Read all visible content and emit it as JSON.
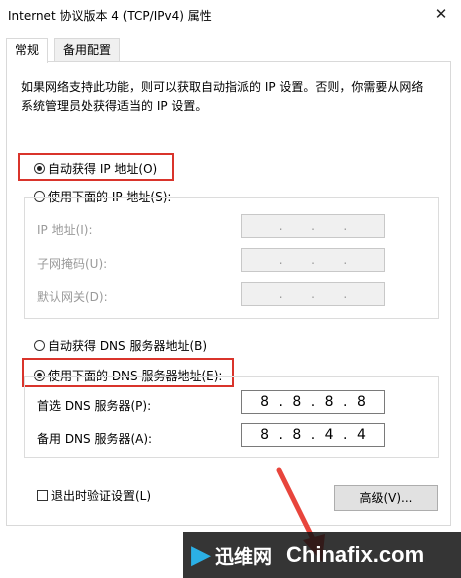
{
  "window": {
    "title": "Internet 协议版本 4 (TCP/IPv4) 属性",
    "close_symbol": "✕"
  },
  "tabs": [
    {
      "label": "常规",
      "active": true
    },
    {
      "label": "备用配置",
      "active": false
    }
  ],
  "description": "如果网络支持此功能，则可以获取自动指派的 IP 设置。否则，你需要从网络系统管理员处获得适当的 IP 设置。",
  "ip_section": {
    "auto_label": "自动获得 IP 地址(O)",
    "auto_checked": true,
    "manual_label": "使用下面的 IP 地址(S):",
    "manual_checked": false,
    "fields": [
      {
        "label": "IP 地址(I):",
        "value": [
          "",
          "",
          "",
          ""
        ]
      },
      {
        "label": "子网掩码(U):",
        "value": [
          "",
          "",
          "",
          ""
        ]
      },
      {
        "label": "默认网关(D):",
        "value": [
          "",
          "",
          "",
          ""
        ]
      }
    ]
  },
  "dns_section": {
    "auto_label": "自动获得 DNS 服务器地址(B)",
    "auto_checked": false,
    "manual_label": "使用下面的 DNS 服务器地址(E):",
    "manual_checked": true,
    "preferred_label": "首选 DNS 服务器(P):",
    "preferred_value": [
      "8",
      "8",
      "8",
      "8"
    ],
    "alternate_label": "备用 DNS 服务器(A):",
    "alternate_value": [
      "8",
      "8",
      "4",
      "4"
    ]
  },
  "validate_label": "退出时验证设置(L)",
  "validate_checked": false,
  "advanced_label": "高级(V)...",
  "watermark": {
    "logo": "迅维网",
    "site": "Chinafix.com"
  },
  "colors": {
    "highlight": "#d9342b",
    "arrow": "#e8453c",
    "watermark_blue": "#2bb0e6"
  }
}
